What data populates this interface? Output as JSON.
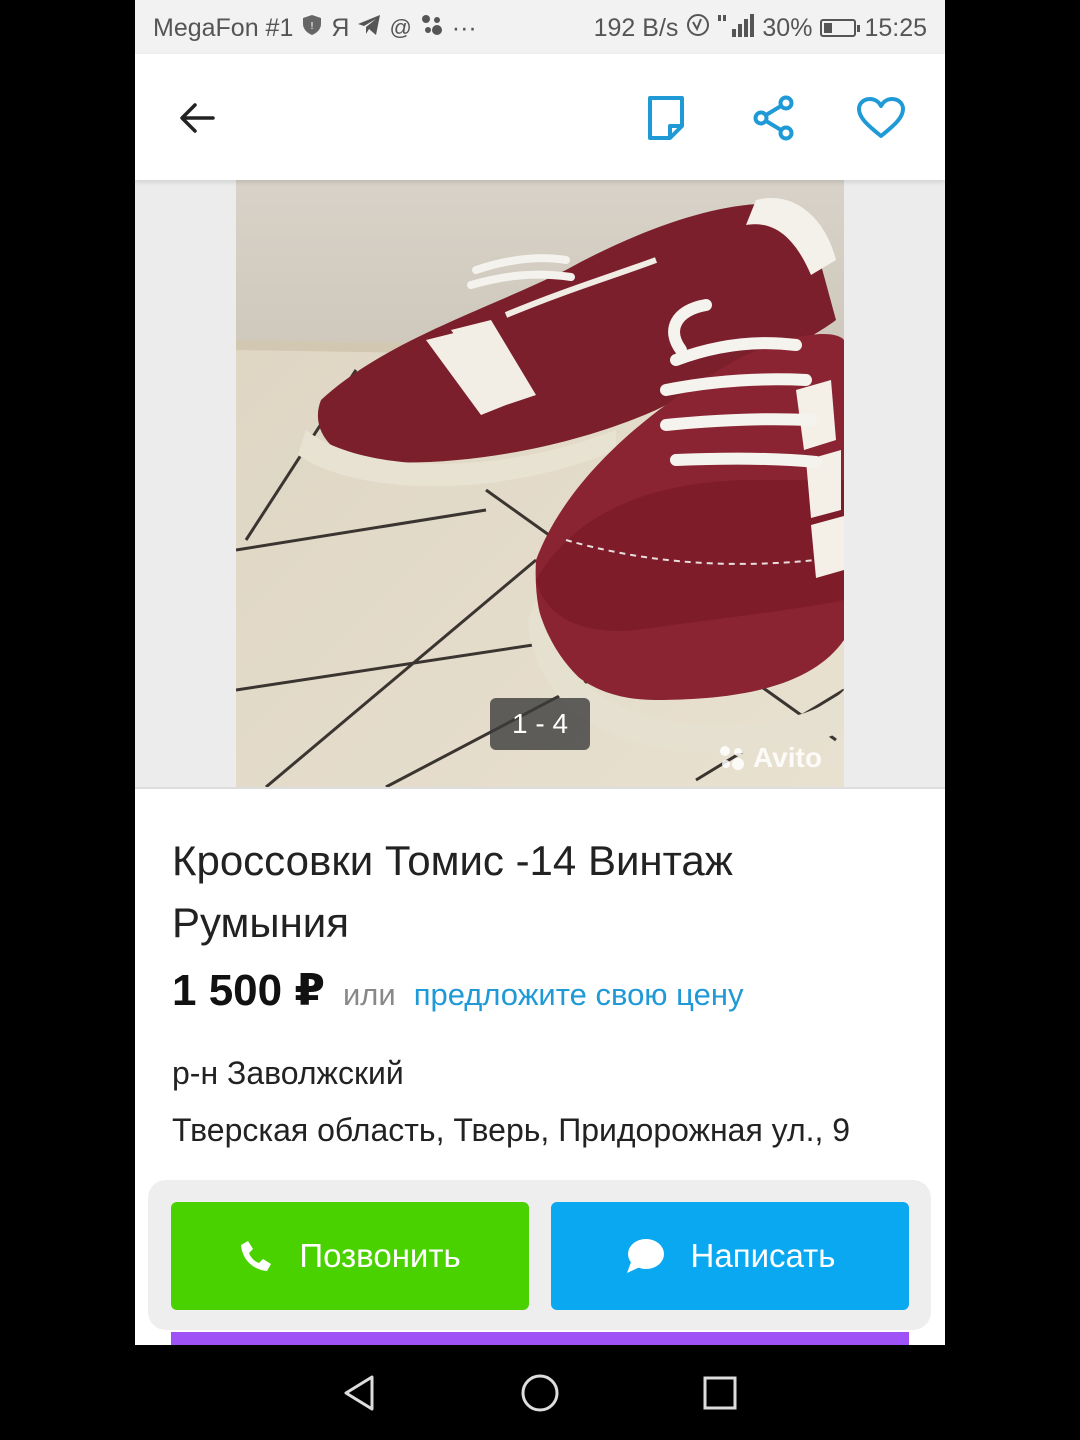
{
  "status_bar": {
    "carrier": "MegaFon #1",
    "ya_label": "Я",
    "more": "···",
    "speed": "192 B/s",
    "battery": "30%",
    "battery_level": 0.3,
    "time": "15:25"
  },
  "toolbar": {
    "back_icon": "arrow-left-icon",
    "note_icon": "note-icon",
    "share_icon": "share-icon",
    "favorite_icon": "heart-icon",
    "accent_color": "#1f9ad6"
  },
  "gallery": {
    "counter": "1 - 4",
    "watermark": "Avito",
    "current": 1,
    "total": 4
  },
  "listing": {
    "title": "Кроссовки Томис -14 Винтаж Румыния",
    "price": "1 500 ₽",
    "or": "или",
    "offer_link": "предложите свою цену",
    "district": "р-н Заволжский",
    "address": "Тверская область, Тверь, Придорожная ул., 9"
  },
  "actions": {
    "call_label": "Позвонить",
    "write_label": "Написать",
    "call_color": "#4ad200",
    "write_color": "#0aa8f0"
  }
}
